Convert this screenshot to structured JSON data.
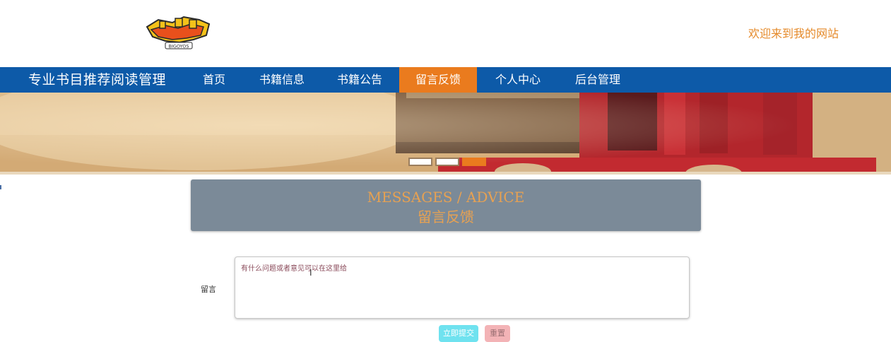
{
  "header": {
    "logo_text": "BIGOYOS",
    "welcome": "欢迎来到我的网站"
  },
  "nav": {
    "site_name": "专业书目推荐阅读管理",
    "items": [
      {
        "label": "首页",
        "active": false
      },
      {
        "label": "书籍信息",
        "active": false
      },
      {
        "label": "书籍公告",
        "active": false
      },
      {
        "label": "留言反馈",
        "active": true
      },
      {
        "label": "个人中心",
        "active": false
      },
      {
        "label": "后台管理",
        "active": false
      }
    ],
    "bg_color": "#0d5aa8",
    "active_color": "#ea7b1e"
  },
  "banner": {
    "slides": 3,
    "active_slide": 3
  },
  "section": {
    "title_en": "MESSAGES / ADVICE",
    "title_cn": "留言反馈",
    "bg_color": "#7b8a98",
    "text_color": "#e7a152"
  },
  "form": {
    "label": "留言",
    "placeholder": "有什么问题或者意见可以在这里给",
    "submit_label": "立即提交",
    "reset_label": "重置"
  }
}
